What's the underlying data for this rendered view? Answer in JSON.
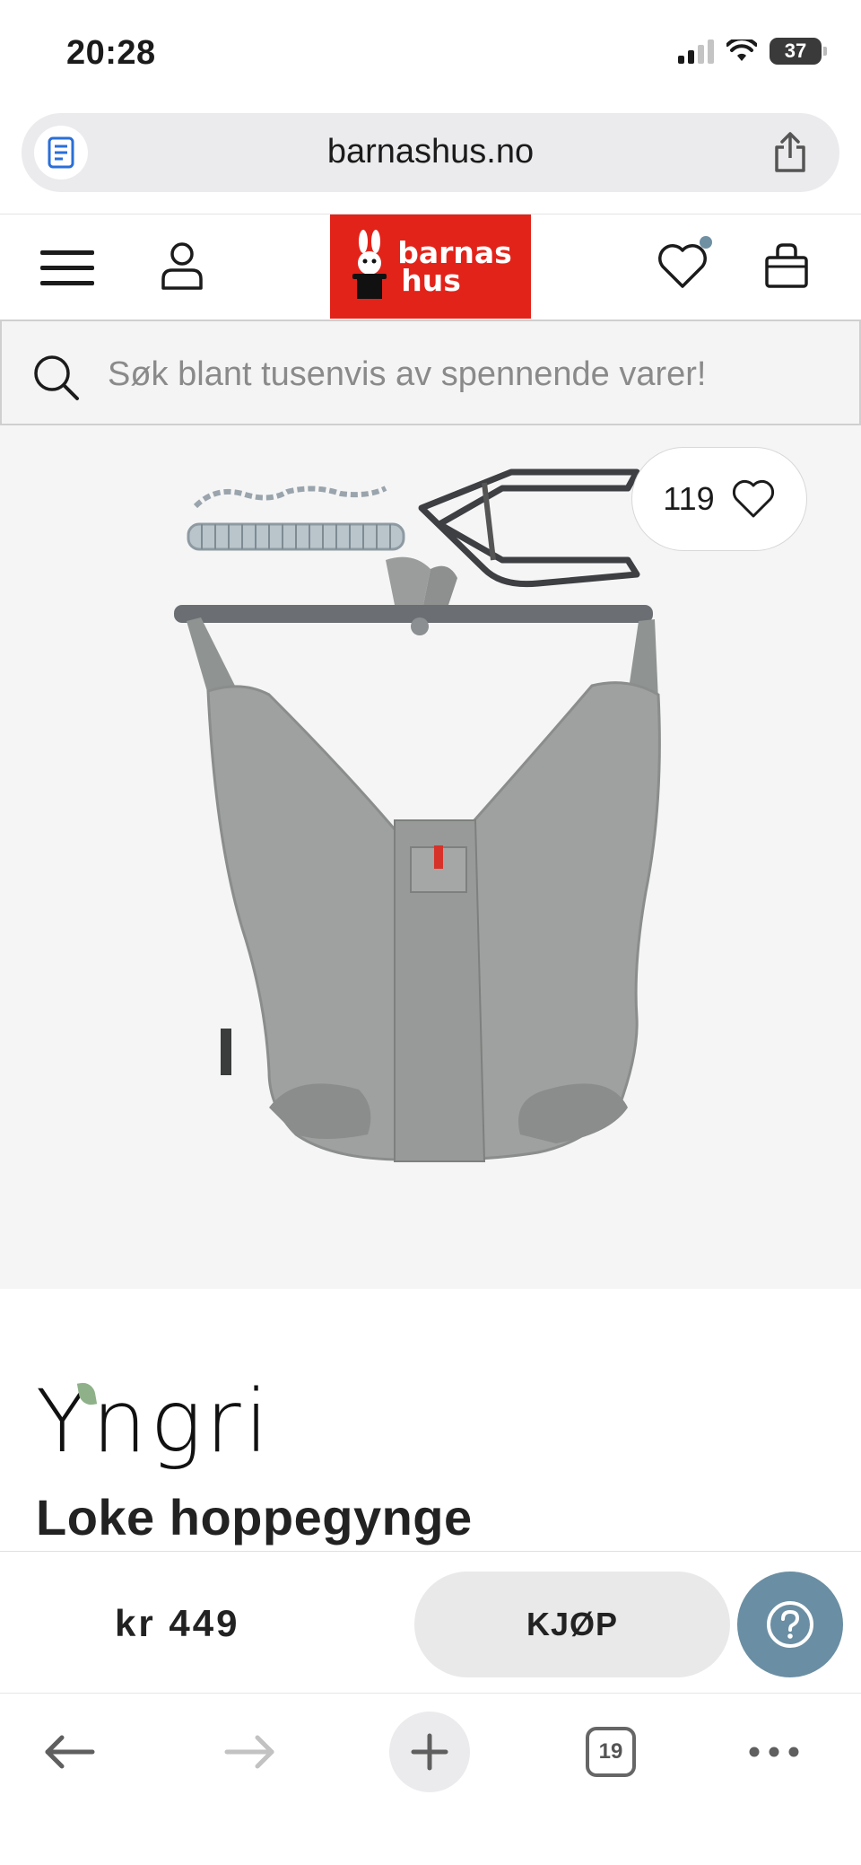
{
  "status_bar": {
    "time": "20:28",
    "battery": "37"
  },
  "browser": {
    "url": "barnashus.no",
    "tabs_count": "19",
    "icons": {
      "reader": "document-icon",
      "share": "share-icon",
      "back": "arrow-left-icon",
      "forward": "arrow-right-icon",
      "new_tab": "plus-icon",
      "tabs": "tabs-icon",
      "more": "more-icon"
    }
  },
  "site_header": {
    "logo_line1": "barnas",
    "logo_line2": "hus",
    "brand_color": "#e2231a",
    "icons": [
      "menu-icon",
      "user-icon",
      "heart-icon",
      "bag-icon"
    ]
  },
  "search": {
    "placeholder": "Søk blant tusenvis av spennende varer!"
  },
  "product": {
    "likes": "119",
    "brand": "Yngri",
    "name": "Loke hoppegynge",
    "price": "kr 449",
    "buy_label": "KJØP"
  },
  "colors": {
    "accent": "#6a8ea3",
    "button_grey": "#e9e9e9"
  }
}
